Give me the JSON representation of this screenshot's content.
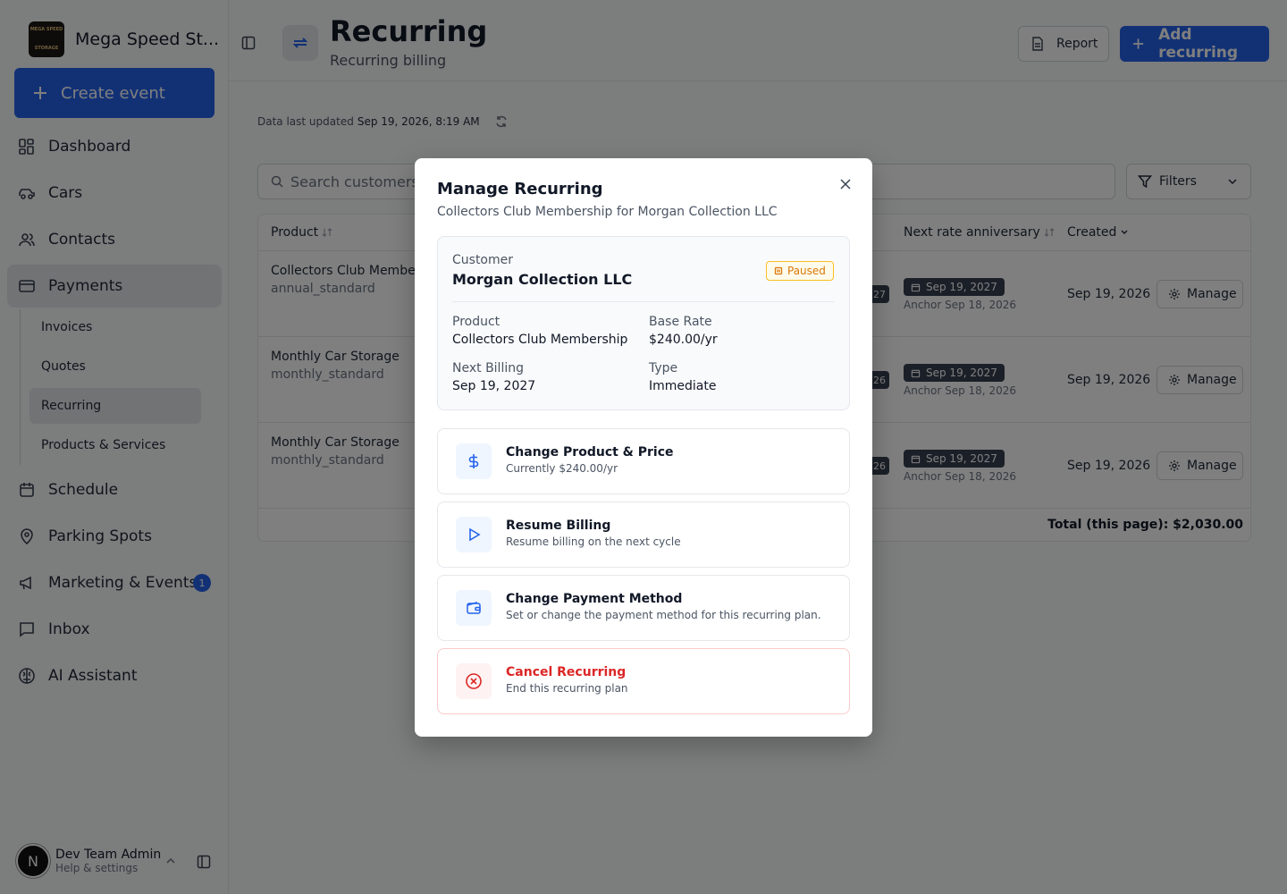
{
  "brand": {
    "name": "Mega Speed St...",
    "logo_line1": "MEGA SPEED",
    "logo_line2": "STORAGE"
  },
  "sidebar": {
    "create_label": "Create event",
    "items": [
      {
        "label": "Dashboard",
        "icon": "dashboard-icon"
      },
      {
        "label": "Cars",
        "icon": "car-icon"
      },
      {
        "label": "Contacts",
        "icon": "users-icon"
      },
      {
        "label": "Payments",
        "icon": "credit-card-icon"
      },
      {
        "label": "Schedule",
        "icon": "calendar-icon"
      },
      {
        "label": "Parking Spots",
        "icon": "map-pin-icon"
      },
      {
        "label": "Marketing & Events",
        "icon": "megaphone-icon",
        "badge": "1"
      },
      {
        "label": "Inbox",
        "icon": "message-icon"
      },
      {
        "label": "AI Assistant",
        "icon": "brain-icon"
      }
    ],
    "sub_items": [
      "Invoices",
      "Quotes",
      "Recurring",
      "Products & Services"
    ],
    "user": {
      "initial": "N",
      "name": "Dev Team Admin",
      "sub": "Help & settings"
    }
  },
  "header": {
    "title": "Recurring",
    "subtitle": "Recurring billing",
    "report_label": "Report",
    "add_label": "Add recurring"
  },
  "status": {
    "prefix": "Data last updated",
    "timestamp": "Sep 19, 2026, 8:19 AM"
  },
  "search": {
    "placeholder": "Search customers..."
  },
  "filters_label": "Filters",
  "table": {
    "columns": {
      "product": "Product",
      "next_rate": "Next rate anniversary",
      "created": "Created"
    },
    "rows": [
      {
        "product": "Collectors Club Membership",
        "plan": "annual_standard",
        "stub": "27",
        "next_rate": "Sep 19, 2027",
        "anchor": "Anchor Sep 18, 2026",
        "created": "Sep 19, 2026",
        "action": "Manage"
      },
      {
        "product": "Monthly Car Storage",
        "plan": "monthly_standard",
        "stub": "26",
        "next_rate": "Sep 19, 2027",
        "anchor": "Anchor Sep 18, 2026",
        "created": "Sep 19, 2026",
        "action": "Manage"
      },
      {
        "product": "Monthly Car Storage",
        "plan": "monthly_standard",
        "stub": "26",
        "next_rate": "Sep 19, 2027",
        "anchor": "Anchor Sep 18, 2026",
        "created": "Sep 19, 2026",
        "action": "Manage"
      }
    ],
    "total": "Total (this page): $2,030.00"
  },
  "modal": {
    "title": "Manage Recurring",
    "subtitle": "Collectors Club Membership for Morgan Collection LLC",
    "customer_label": "Customer",
    "customer_name": "Morgan Collection LLC",
    "status": "Paused",
    "product_label": "Product",
    "product_value": "Collectors Club Membership",
    "rate_label": "Base Rate",
    "rate_value": "$240.00/yr",
    "next_label": "Next Billing",
    "next_value": "Sep 19, 2027",
    "type_label": "Type",
    "type_value": "Immediate",
    "actions": [
      {
        "title": "Change Product & Price",
        "desc": "Currently $240.00/yr",
        "icon": "dollar-icon"
      },
      {
        "title": "Resume Billing",
        "desc": "Resume billing on the next cycle",
        "icon": "play-icon"
      },
      {
        "title": "Change Payment Method",
        "desc": "Set or change the payment method for this recurring plan.",
        "icon": "wallet-icon"
      },
      {
        "title": "Cancel Recurring",
        "desc": "End this recurring plan",
        "icon": "cancel-circle-icon"
      }
    ]
  },
  "colors": {
    "accent": "#2563eb",
    "danger": "#dc2626",
    "warning": "#d97706"
  }
}
